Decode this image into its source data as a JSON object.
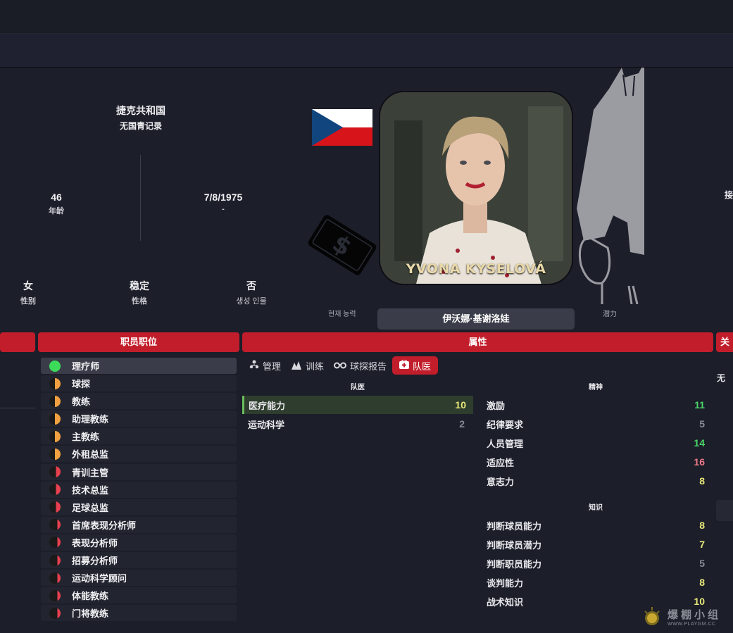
{
  "nation": {
    "name": "捷克共和国",
    "youth_record": "无国青记录"
  },
  "bio": {
    "age": {
      "value": "46",
      "label": "年龄"
    },
    "dob": {
      "value": "7/8/1975",
      "label": "-"
    },
    "gender": {
      "value": "女",
      "label": "性别"
    },
    "personality": {
      "value": "稳定",
      "label": "性格"
    },
    "other": {
      "value": "否",
      "label": "생성 인물"
    }
  },
  "portrait": {
    "name_overlay": "YVONA KYSELOVÁ"
  },
  "labels": {
    "current_ability": "현재 능력",
    "potential": "潜力"
  },
  "person_name": "伊沃娜·基谢洛娃",
  "headers": {
    "staff_roles": "职员职位",
    "attributes": "属性",
    "right_cut": "关"
  },
  "right_edge": {
    "text_a": "无",
    "text_b": "接"
  },
  "staff_roles": [
    {
      "label": "理疗师",
      "status": "full",
      "selected": true
    },
    {
      "label": "球探",
      "status": "half"
    },
    {
      "label": "教练",
      "status": "half"
    },
    {
      "label": "助理教练",
      "status": "half"
    },
    {
      "label": "主教练",
      "status": "half"
    },
    {
      "label": "外租总监",
      "status": "half"
    },
    {
      "label": "青训主管",
      "status": "low"
    },
    {
      "label": "技术总监",
      "status": "low"
    },
    {
      "label": "足球总监",
      "status": "low"
    },
    {
      "label": "首席表现分析师",
      "status": "vlow"
    },
    {
      "label": "表现分析师",
      "status": "vlow"
    },
    {
      "label": "招募分析师",
      "status": "vlow"
    },
    {
      "label": "运动科学顾问",
      "status": "vlow"
    },
    {
      "label": "体能教练",
      "status": "vlow"
    },
    {
      "label": "门将教练",
      "status": "vlow"
    }
  ],
  "tabs": [
    {
      "label": "管理",
      "icon": "management-icon"
    },
    {
      "label": "训练",
      "icon": "training-icon"
    },
    {
      "label": "球探报告",
      "icon": "binoculars-icon"
    },
    {
      "label": "队医",
      "icon": "medical-kit-icon",
      "active": true
    }
  ],
  "sections": {
    "medical": {
      "title": "队医",
      "attributes": [
        {
          "label": "医疗能力",
          "value": "10",
          "highlight": true
        },
        {
          "label": "运动科学",
          "value": "2"
        }
      ]
    },
    "mental": {
      "title": "精神",
      "attributes": [
        {
          "label": "激励",
          "value": "11"
        },
        {
          "label": "纪律要求",
          "value": "5"
        },
        {
          "label": "人员管理",
          "value": "14"
        },
        {
          "label": "适应性",
          "value": "16"
        },
        {
          "label": "意志力",
          "value": "8"
        }
      ]
    },
    "knowledge": {
      "title": "知识",
      "attributes": [
        {
          "label": "判断球员能力",
          "value": "8"
        },
        {
          "label": "判断球员潜力",
          "value": "7"
        },
        {
          "label": "判断职员能力",
          "value": "5"
        },
        {
          "label": "谈判能力",
          "value": "8"
        },
        {
          "label": "战术知识",
          "value": "10"
        }
      ]
    }
  },
  "watermark": {
    "text": "爆棚小组",
    "url": "WWW.PLAYGM.CC"
  },
  "colors": {
    "accent_red": "#c21d2b",
    "value_yellow": "#e9e87a",
    "value_green": "#4ad86a",
    "value_gray": "#8a8d96",
    "value_pink": "#f07a8a"
  }
}
